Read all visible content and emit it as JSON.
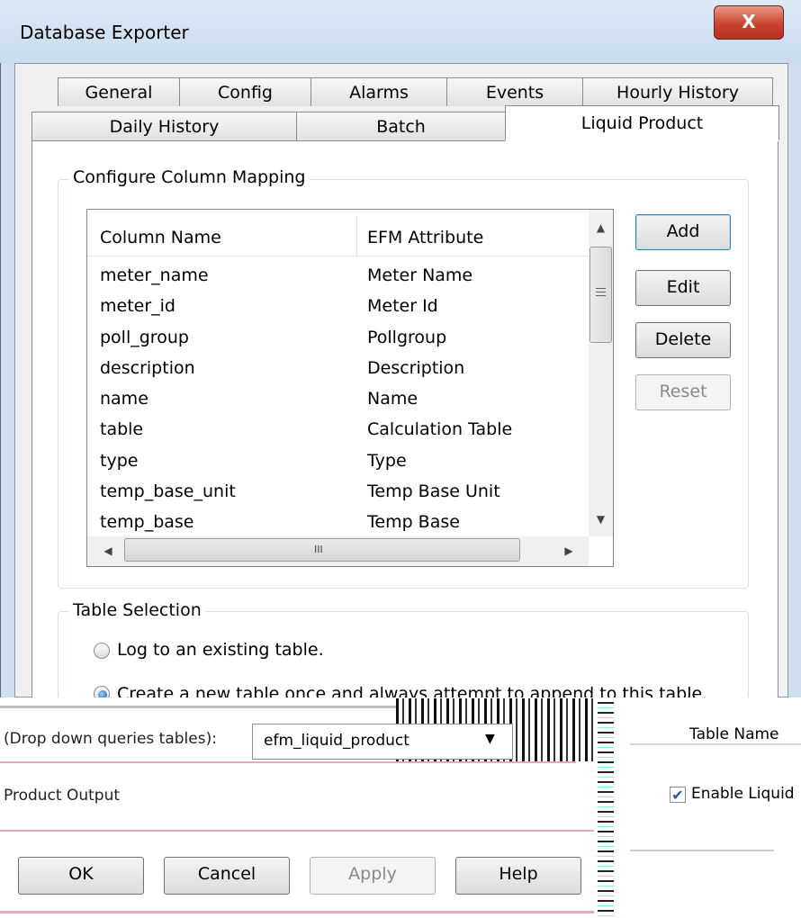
{
  "window": {
    "title": "Database Exporter",
    "close_glyph": "X"
  },
  "tabs_row1": [
    "General",
    "Config",
    "Alarms",
    "Events",
    "Hourly History"
  ],
  "tabs_row2": [
    "Daily History",
    "Batch",
    "Liquid Product"
  ],
  "active_tab": "Liquid Product",
  "mapping": {
    "group_label": "Configure Column Mapping",
    "columns": [
      "Column Name",
      "EFM Attribute"
    ],
    "rows": [
      [
        "meter_name",
        "Meter Name"
      ],
      [
        "meter_id",
        "Meter Id"
      ],
      [
        "poll_group",
        "Pollgroup"
      ],
      [
        "description",
        "Description"
      ],
      [
        "name",
        "Name"
      ],
      [
        "table",
        "Calculation Table"
      ],
      [
        "type",
        "Type"
      ],
      [
        "temp_base_unit",
        "Temp Base Unit"
      ],
      [
        "temp_base",
        "Temp Base"
      ]
    ],
    "buttons": {
      "add": "Add",
      "edit": "Edit",
      "delete": "Delete",
      "reset": "Reset"
    }
  },
  "table_selection": {
    "group_label": "Table Selection",
    "option_existing": "Log to an existing table.",
    "option_new": "Create a new table once and always attempt to append to this table.",
    "selected": "new"
  },
  "overlay": {
    "dropdown_label": "(Drop down queries tables):",
    "dropdown_value": "efm_liquid_product",
    "table_name_label": "Table Name",
    "product_output_label": "Product Output",
    "enable_label": "Enable Liquid",
    "enable_checked": true
  },
  "footer": {
    "ok": "OK",
    "cancel": "Cancel",
    "apply": "Apply",
    "help": "Help"
  },
  "colors": {
    "close": "#c8432e",
    "frame": "#cfdff0",
    "accent_pink": "#e8a6c2"
  }
}
